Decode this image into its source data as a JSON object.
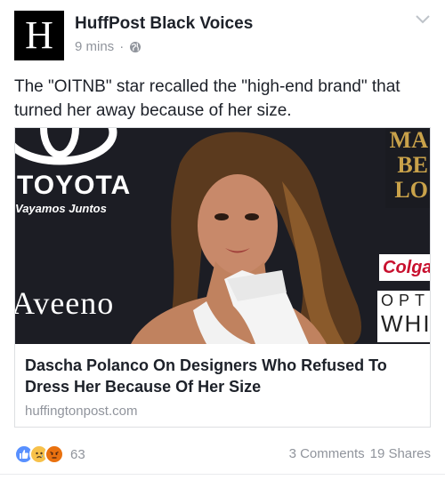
{
  "post": {
    "page_name": "HuffPost Black Voices",
    "logo_letter": "H",
    "time": "9 mins",
    "separator": "·",
    "caption": "The \"OITNB\" star recalled the \"high-end brand\" that turned her away because of her size."
  },
  "link": {
    "title": "Dascha Polanco On Designers Who Refused To Dress Her Because Of Her Size",
    "domain": "huffingtonpost.com"
  },
  "photo_backdrop": {
    "toyota": "TOYOTA",
    "toyota_tagline": "Vayamos Juntos",
    "aveeno": "Aveeno",
    "colgate": "Colga",
    "opt_line1": "OPT",
    "opt_line2": "WHI",
    "mabelo_lines": [
      "MA",
      "BE",
      "LO"
    ]
  },
  "footer": {
    "reaction_count": "63",
    "comments": "3 Comments",
    "shares": "19 Shares"
  },
  "colors": {
    "text": "#1d2129",
    "meta": "#90949c",
    "like_blue": "#5890ff",
    "sad_yellow": "#f7c14a",
    "angry_red": "#e9710f"
  },
  "icons": [
    "globe-icon",
    "chevron-down-icon",
    "like-reaction-icon",
    "sad-reaction-icon",
    "angry-reaction-icon"
  ]
}
